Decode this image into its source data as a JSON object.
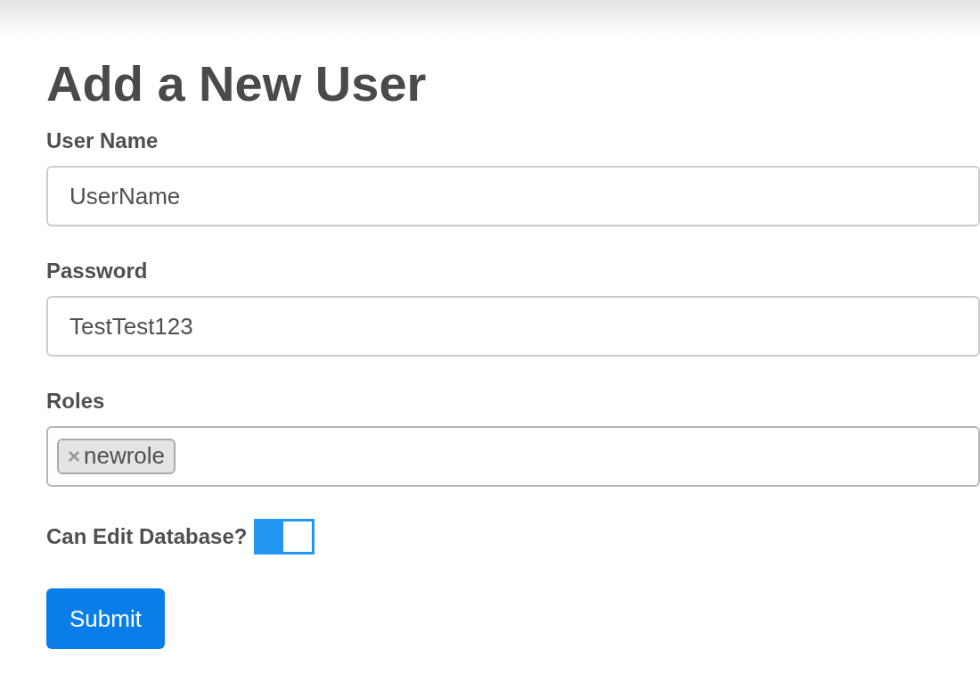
{
  "title": "Add a New User",
  "fields": [
    {
      "label": "User Name",
      "value": "UserName"
    },
    {
      "label": "Password",
      "value": "TestTest123"
    }
  ],
  "roles": {
    "label": "Roles",
    "tags": [
      {
        "remove": "×",
        "text": "newrole"
      }
    ]
  },
  "can_edit": {
    "label": "Can Edit Database?",
    "on": true
  },
  "submit": "Submit"
}
